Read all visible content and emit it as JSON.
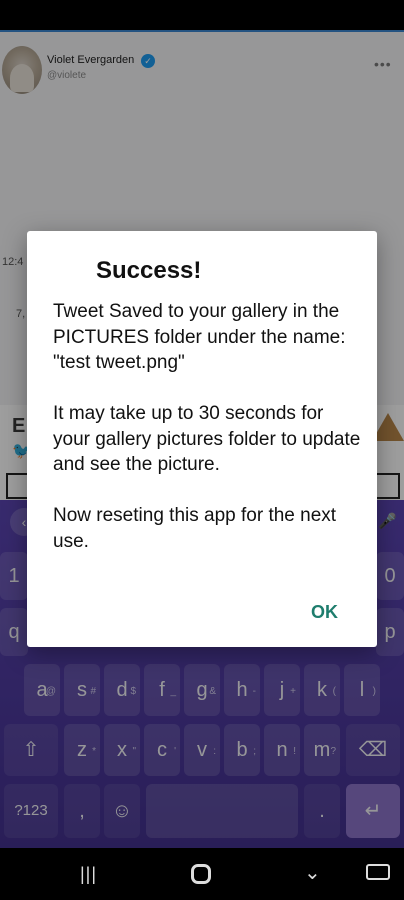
{
  "tweet": {
    "name": "Violet Evergarden",
    "handle": "@violete",
    "verified_icon": "verified-badge-icon",
    "more_icon": "more-options-icon",
    "time": "12:4",
    "date": "7,"
  },
  "editor": {
    "letter": "E",
    "bird_icon": "twitter-bird-icon",
    "warning_icon": "warning-triangle-icon"
  },
  "keyboard": {
    "back_icon": "keyboard-back-icon",
    "mic_icon": "microphone-icon",
    "row_top": {
      "left": {
        "label": "1",
        "hint": ""
      },
      "right": {
        "label": "0",
        "hint": ""
      }
    },
    "row_mid": {
      "left": {
        "label": "q",
        "hint": ""
      },
      "right": {
        "label": "p",
        "hint": ""
      }
    },
    "row_a": [
      {
        "label": "a",
        "hint": "@"
      },
      {
        "label": "s",
        "hint": "#"
      },
      {
        "label": "d",
        "hint": "$"
      },
      {
        "label": "f",
        "hint": "_"
      },
      {
        "label": "g",
        "hint": "&"
      },
      {
        "label": "h",
        "hint": "-"
      },
      {
        "label": "j",
        "hint": "+"
      },
      {
        "label": "k",
        "hint": "("
      },
      {
        "label": "l",
        "hint": ")"
      }
    ],
    "row_z": [
      {
        "label": "z",
        "hint": "*"
      },
      {
        "label": "x",
        "hint": "\""
      },
      {
        "label": "c",
        "hint": "'"
      },
      {
        "label": "v",
        "hint": ":"
      },
      {
        "label": "b",
        "hint": ";"
      },
      {
        "label": "n",
        "hint": "!"
      },
      {
        "label": "m",
        "hint": "?"
      }
    ],
    "shift_icon": "shift-icon",
    "backspace_icon": "backspace-icon",
    "symbols_label": "?123",
    "comma_label": ",",
    "emoji_icon": "emoji-icon",
    "period_label": ".",
    "enter_icon": "enter-icon"
  },
  "navigation": {
    "recent_icon": "recent-apps-icon",
    "home_icon": "home-icon",
    "back_icon": "back-chevron-icon",
    "keyboard_icon": "keyboard-switch-icon"
  },
  "dialog": {
    "title": "Success!",
    "message": "Tweet Saved to your gallery in the PICTURES folder under the name:\n\"test tweet.png\"\n\nIt may take up to 30 seconds for your gallery pictures folder to update and see the picture.\n\nNow reseting this app for the next use.",
    "ok_label": "OK"
  },
  "colors": {
    "accent_teal": "#1e7d6d",
    "keyboard_purple": "#4f3aa0",
    "twitter_blue": "#1d9bf0"
  }
}
